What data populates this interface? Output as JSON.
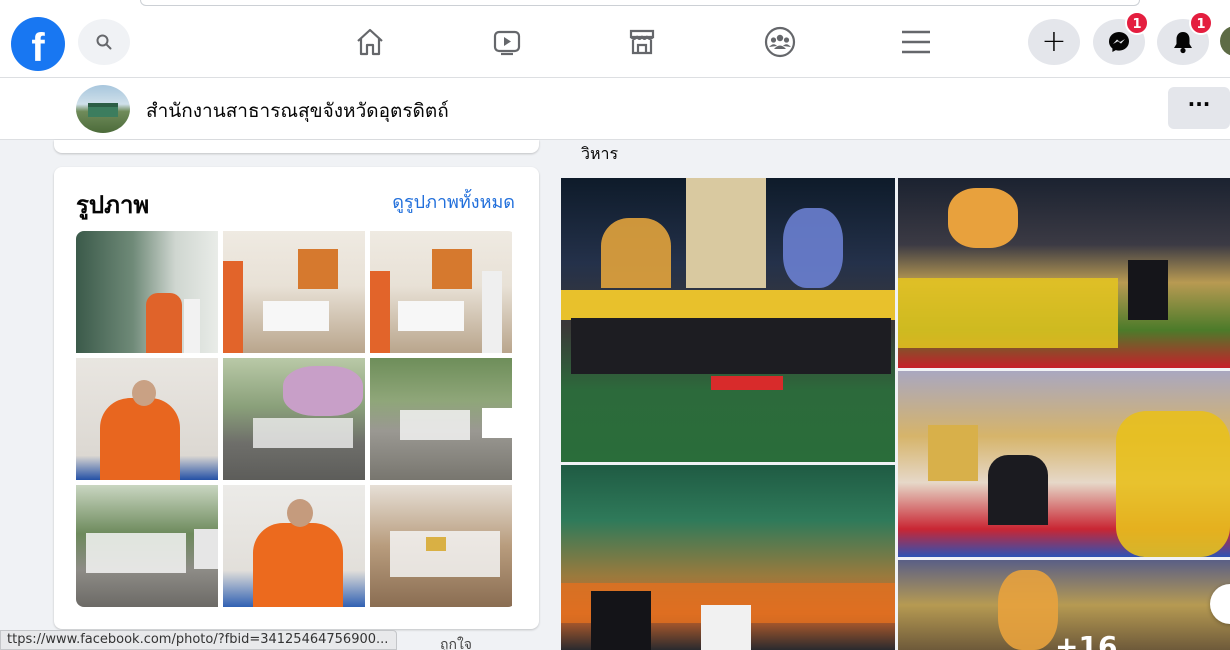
{
  "topbar": {
    "logo_letter": "f",
    "icons": {
      "search": "search-icon",
      "home": "home-icon",
      "watch": "video-icon",
      "marketplace": "marketplace-icon",
      "groups": "groups-icon",
      "menu": "menu-icon",
      "create": "plus-icon",
      "messenger": "messenger-icon",
      "notifications": "bell-icon"
    },
    "create_label": "+",
    "messenger_badge": "1",
    "notifications_badge": "1"
  },
  "page_header": {
    "name": "สำนักงานสาธารณสุขจังหวัดอุตรดิตถ์",
    "more_label": "···"
  },
  "photos_card": {
    "title": "รูปภาพ",
    "see_all": "ดูรูปภาพทั้งหมด"
  },
  "feed": {
    "caption": "วิหาร",
    "overlay_count": "+16"
  },
  "status_bar": {
    "url": "ttps://www.facebook.com/photo/?fbid=34125464756900...",
    "tail": "ถูกใจ"
  },
  "colors": {
    "brand": "#1877f2",
    "link": "#216fdb",
    "badge": "#e41e3f",
    "background": "#f0f2f5"
  }
}
